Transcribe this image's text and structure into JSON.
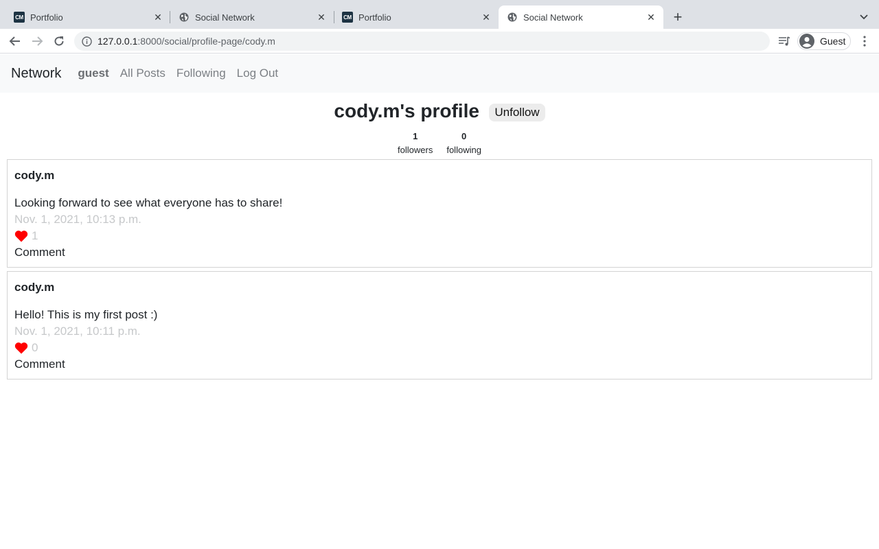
{
  "browser": {
    "tabs": [
      {
        "title": "Portfolio",
        "favicon": "cm-logo-icon",
        "active": false
      },
      {
        "title": "Social Network",
        "favicon": "globe-icon",
        "active": false
      },
      {
        "title": "Portfolio",
        "favicon": "cm-logo-icon",
        "active": false
      },
      {
        "title": "Social Network",
        "favicon": "globe-icon",
        "active": true
      }
    ],
    "cm_favicon_text": "CM",
    "url_host": "127.0.0.1",
    "url_path": ":8000/social/profile-page/cody.m",
    "profile_label": "Guest"
  },
  "navbar": {
    "brand": "Network",
    "user": "guest",
    "links": [
      "All Posts",
      "Following",
      "Log Out"
    ]
  },
  "profile": {
    "title": "cody.m's profile",
    "follow_button": "Unfollow",
    "followers_count": "1",
    "followers_label": "followers",
    "following_count": "0",
    "following_label": "following"
  },
  "posts": [
    {
      "author": "cody.m",
      "content": "Looking forward to see what everyone has to share!",
      "timestamp": "Nov. 1, 2021, 10:13 p.m.",
      "likes": "1",
      "comment_label": "Comment"
    },
    {
      "author": "cody.m",
      "content": "Hello! This is my first post :)",
      "timestamp": "Nov. 1, 2021, 10:11 p.m.",
      "likes": "0",
      "comment_label": "Comment"
    }
  ],
  "colors": {
    "tabstrip": "#dee1e6",
    "navbar_bg": "#f8f9fa",
    "heart": "#ff0000",
    "muted_text": "#c6c8ca"
  }
}
